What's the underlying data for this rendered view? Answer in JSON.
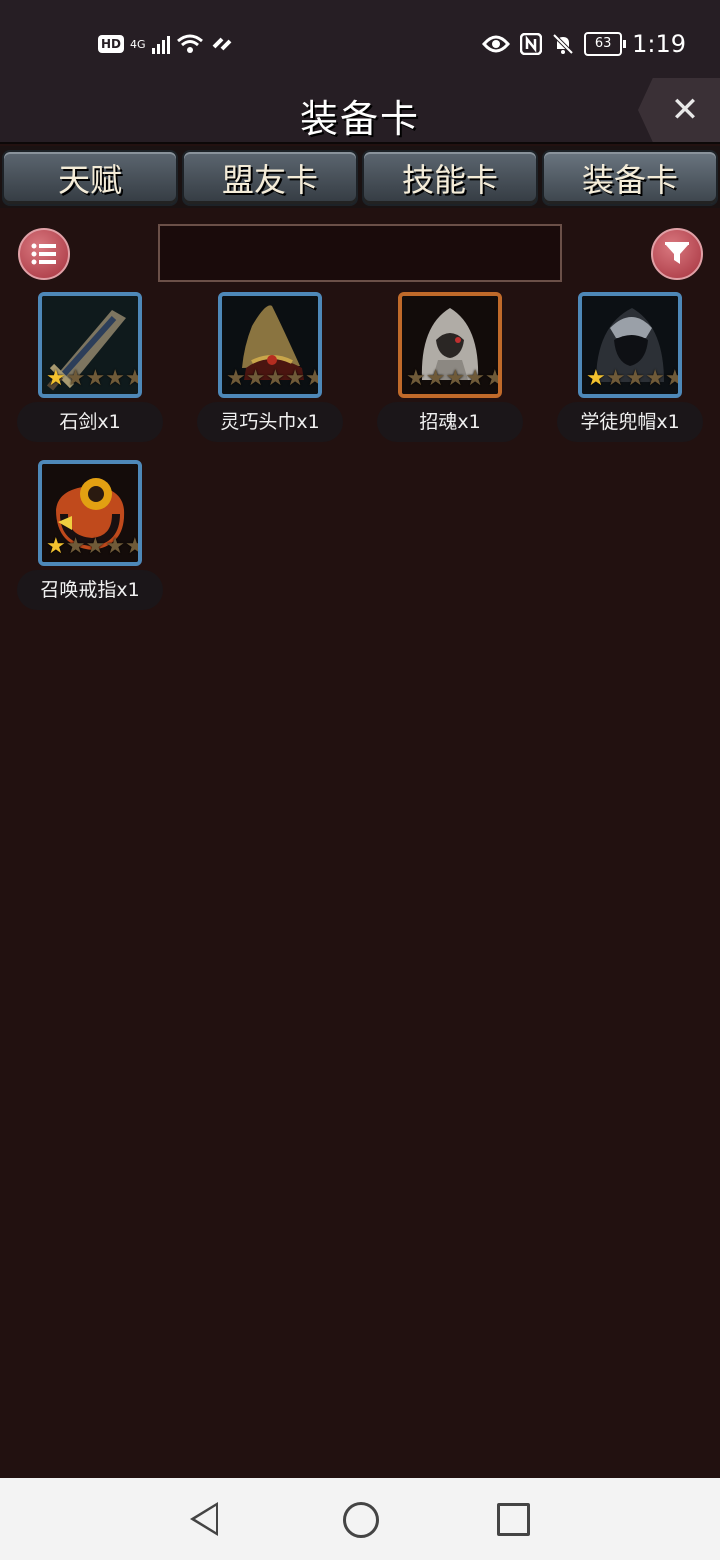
{
  "status_bar": {
    "hd_label": "HD",
    "network_label": "4G",
    "battery_level": "63",
    "time": "1:19",
    "icons": [
      "hd-icon",
      "signal-icon",
      "wifi-icon",
      "link-icon",
      "eye-icon",
      "nfc-icon",
      "mute-bell-icon",
      "battery-icon"
    ]
  },
  "header": {
    "title": "装备卡",
    "close_symbol": "✕"
  },
  "tabs": [
    {
      "label": "天赋",
      "active": false
    },
    {
      "label": "盟友卡",
      "active": false
    },
    {
      "label": "技能卡",
      "active": false
    },
    {
      "label": "装备卡",
      "active": true
    }
  ],
  "toolbar": {
    "list_icon": "list-icon",
    "filter_icon": "filter-icon",
    "search_value": ""
  },
  "cards": [
    {
      "label": "石剑x1",
      "stars_on": 1,
      "stars_total": 5,
      "frame": "blue",
      "icon": "stone-sword-icon"
    },
    {
      "label": "灵巧头巾x1",
      "stars_on": 0,
      "stars_total": 5,
      "frame": "blue",
      "icon": "headscarf-icon"
    },
    {
      "label": "招魂x1",
      "stars_on": 0,
      "stars_total": 5,
      "frame": "orange",
      "icon": "ghost-hood-icon"
    },
    {
      "label": "学徒兜帽x1",
      "stars_on": 1,
      "stars_total": 5,
      "frame": "blue",
      "icon": "apprentice-hood-icon"
    },
    {
      "label": "召唤戒指x1",
      "stars_on": 1,
      "stars_total": 5,
      "frame": "blue",
      "icon": "summon-ring-icon"
    }
  ],
  "colors": {
    "background": "#221110",
    "frame_blue": "#4e88b8",
    "frame_orange": "#c06a2a",
    "star_on": "#f2c12e",
    "round_button": "#b84450"
  }
}
